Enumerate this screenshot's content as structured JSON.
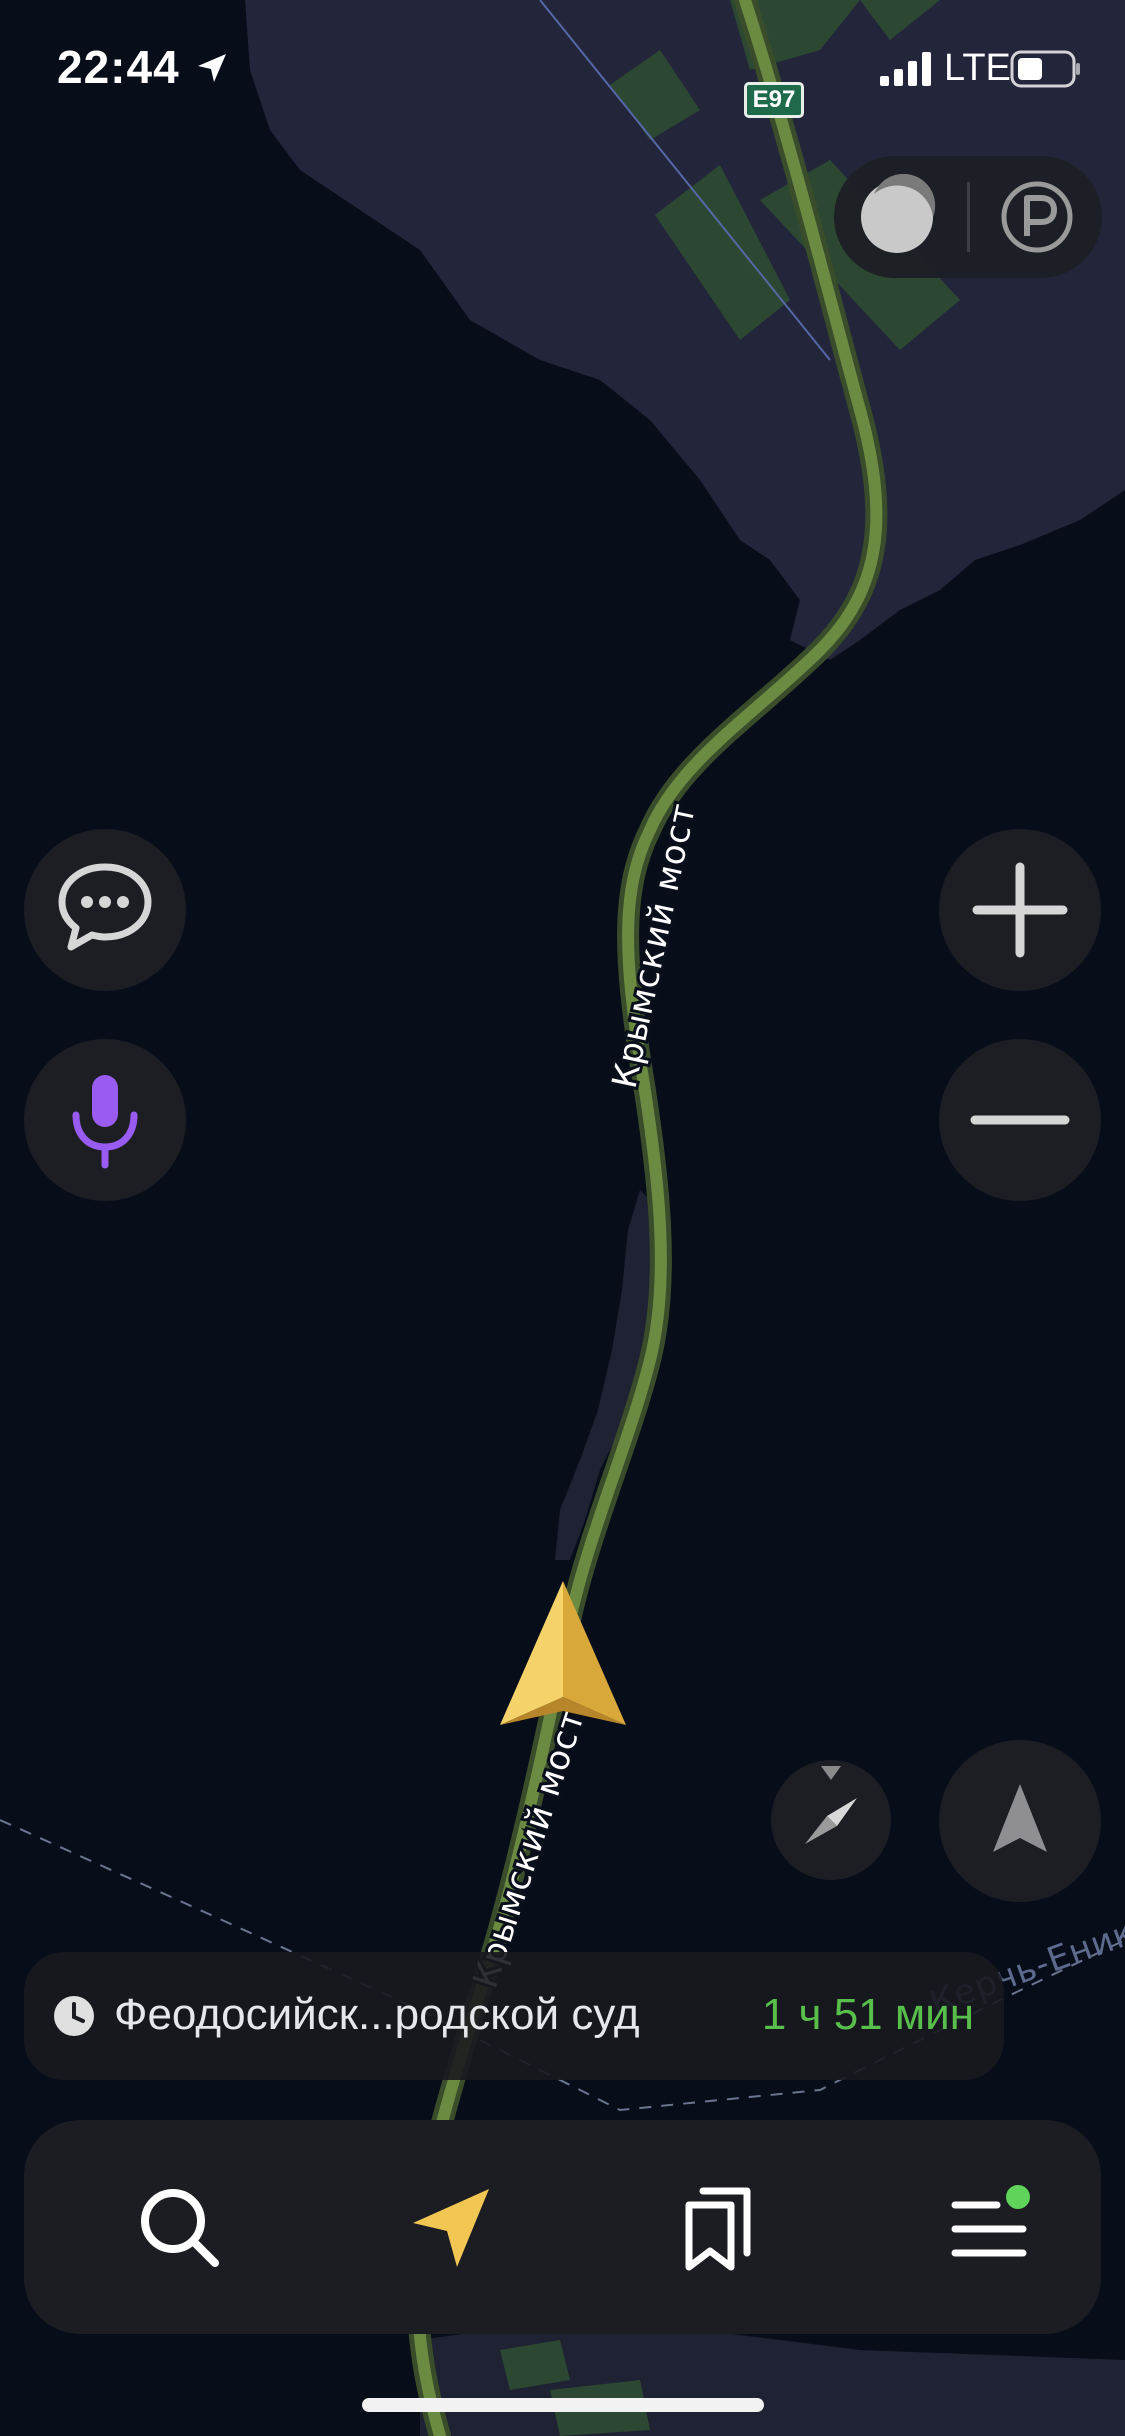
{
  "status_bar": {
    "time": "22:44",
    "network": "LTE",
    "icons": [
      "location-arrow-icon",
      "signal-bars-icon",
      "battery-icon"
    ]
  },
  "map": {
    "road_sign": "E97",
    "road_labels": [
      "Крымский мост",
      "Крымский мост"
    ],
    "far_road_label": "Керчь-Еникал",
    "colors": {
      "water": "#080d1a",
      "land": "#23263a",
      "fields": "#2c4832",
      "route": "#5f7c3c",
      "user_arrow": "#f1c653"
    }
  },
  "layers": {
    "traffic_icon": "traffic-layer-icon",
    "parking_icon": "parking-layer-icon"
  },
  "controls": {
    "chat_icon": "chat-bubble-icon",
    "mic_icon": "microphone-icon",
    "zoom_in_icon": "plus-icon",
    "zoom_out_icon": "minus-icon",
    "compass_icon": "compass-icon",
    "locate_icon": "locate-arrow-icon",
    "accent_mic": "#9a5cf0"
  },
  "route": {
    "destination": "Феодосийск...родской суд",
    "eta": "1 ч 51 мин",
    "eta_color": "#58c04a"
  },
  "bottom_nav": {
    "items": [
      {
        "icon": "search-icon"
      },
      {
        "icon": "navigation-arrow-icon",
        "active_color": "#f1c653"
      },
      {
        "icon": "bookmarks-icon"
      },
      {
        "icon": "menu-icon",
        "badge_color": "#5fd35a"
      }
    ]
  }
}
